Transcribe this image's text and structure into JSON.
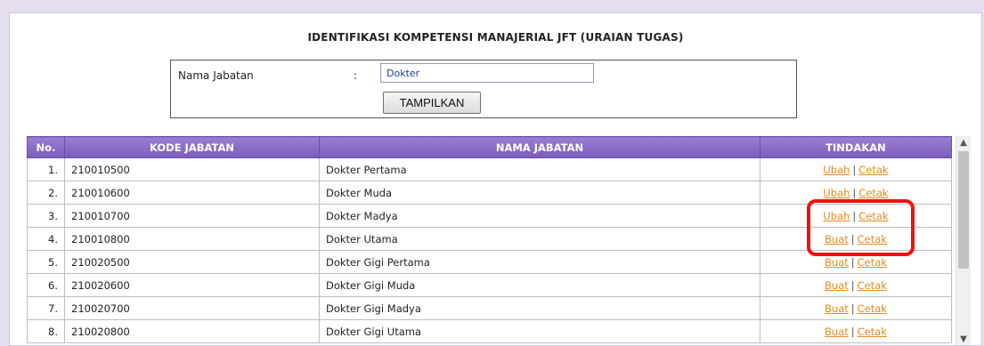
{
  "page": {
    "title": "IDENTIFIKASI KOMPETENSI MANAJERIAL JFT (URAIAN TUGAS)"
  },
  "form": {
    "label": "Nama Jabatan",
    "colon": ":",
    "input_value": "Dokter",
    "button_label": "TAMPILKAN"
  },
  "table": {
    "headers": [
      "No.",
      "KODE JABATAN",
      "NAMA JABATAN",
      "TINDAKAN"
    ],
    "rows": [
      {
        "no": "1.",
        "kode": "210010500",
        "nama": "Dokter Pertama",
        "action1": "Ubah",
        "sep": "|",
        "action2": "Cetak"
      },
      {
        "no": "2.",
        "kode": "210010600",
        "nama": "Dokter Muda",
        "action1": "Ubah",
        "sep": "|",
        "action2": "Cetak"
      },
      {
        "no": "3.",
        "kode": "210010700",
        "nama": "Dokter Madya",
        "action1": "Ubah",
        "sep": "|",
        "action2": "Cetak"
      },
      {
        "no": "4.",
        "kode": "210010800",
        "nama": "Dokter Utama",
        "action1": "Buat",
        "sep": "|",
        "action2": "Cetak"
      },
      {
        "no": "5.",
        "kode": "210020500",
        "nama": "Dokter Gigi Pertama",
        "action1": "Buat",
        "sep": "|",
        "action2": "Cetak"
      },
      {
        "no": "6.",
        "kode": "210020600",
        "nama": "Dokter Gigi Muda",
        "action1": "Buat",
        "sep": "|",
        "action2": "Cetak"
      },
      {
        "no": "7.",
        "kode": "210020700",
        "nama": "Dokter Gigi Madya",
        "action1": "Buat",
        "sep": "|",
        "action2": "Cetak"
      },
      {
        "no": "8.",
        "kode": "210020800",
        "nama": "Dokter Gigi Utama",
        "action1": "Buat",
        "sep": "|",
        "action2": "Cetak"
      }
    ]
  },
  "colors": {
    "header_bg": "#8a6ec8",
    "link": "#e8891c",
    "highlight": "#ee1111",
    "page_bg": "#e4def0"
  },
  "icons": {
    "scroll_up": "chevron-up-icon",
    "scroll_down": "chevron-down-icon"
  }
}
